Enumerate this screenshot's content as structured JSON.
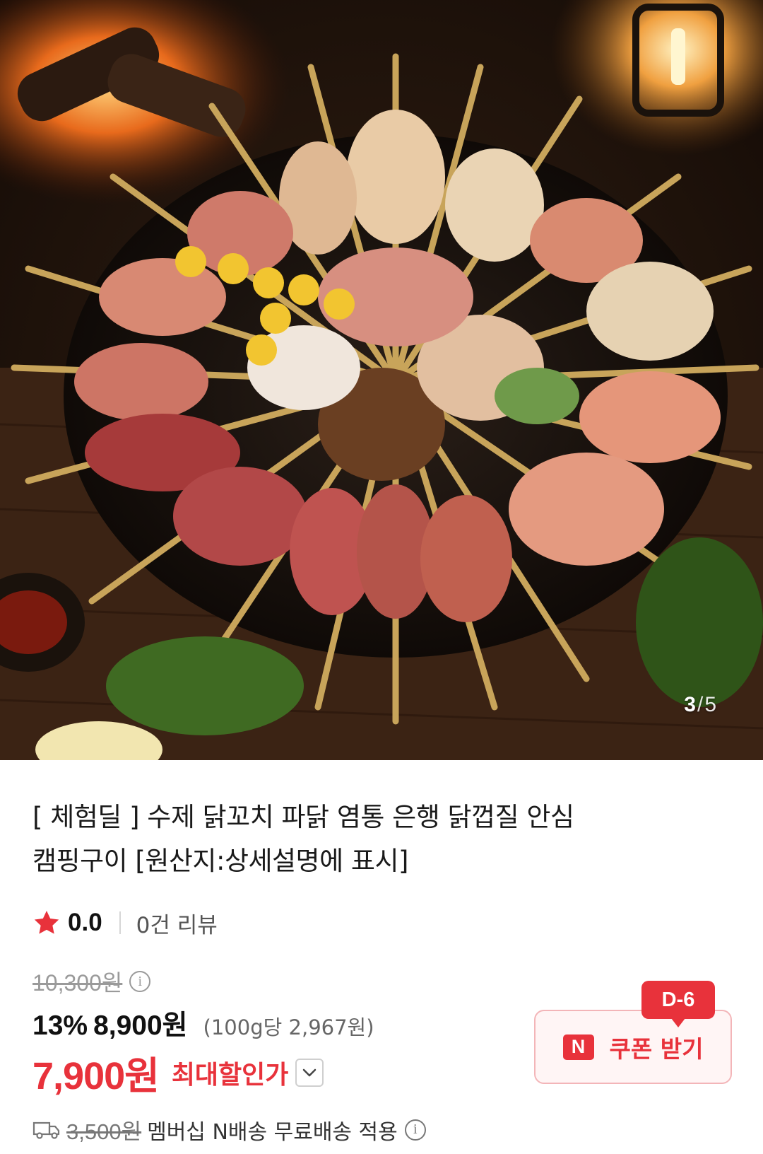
{
  "gallery": {
    "current": "3",
    "separator": "/",
    "total": "5"
  },
  "product": {
    "title_line1": "[ 체험딜 ] 수제 닭꼬치 파닭 염통 은행 닭껍질 안심",
    "title_line2": "캠핑구이 [원산지:상세설명에 표시]"
  },
  "rating": {
    "score": "0.0",
    "reviews": "0건 리뷰"
  },
  "price": {
    "original": "10,300원",
    "discount_percent": "13%",
    "sale": "8,900원",
    "unit_price": "(100g당 2,967원)",
    "final": "7,900원",
    "final_label": "최대할인가"
  },
  "coupon": {
    "badge": "N",
    "label": "쿠폰 받기",
    "dday": "D-6"
  },
  "shipping": {
    "original_fee": "3,500원",
    "text": "멤버십 N배송 무료배송 적용"
  },
  "icons": {
    "star": "star-icon",
    "info": "info-icon",
    "chevron": "chevron-down-icon",
    "truck": "truck-icon"
  },
  "colors": {
    "accent": "#e8323b",
    "star": "#e8323b",
    "coupon_bg": "#fff5f5",
    "coupon_border": "#f3b5b8"
  }
}
